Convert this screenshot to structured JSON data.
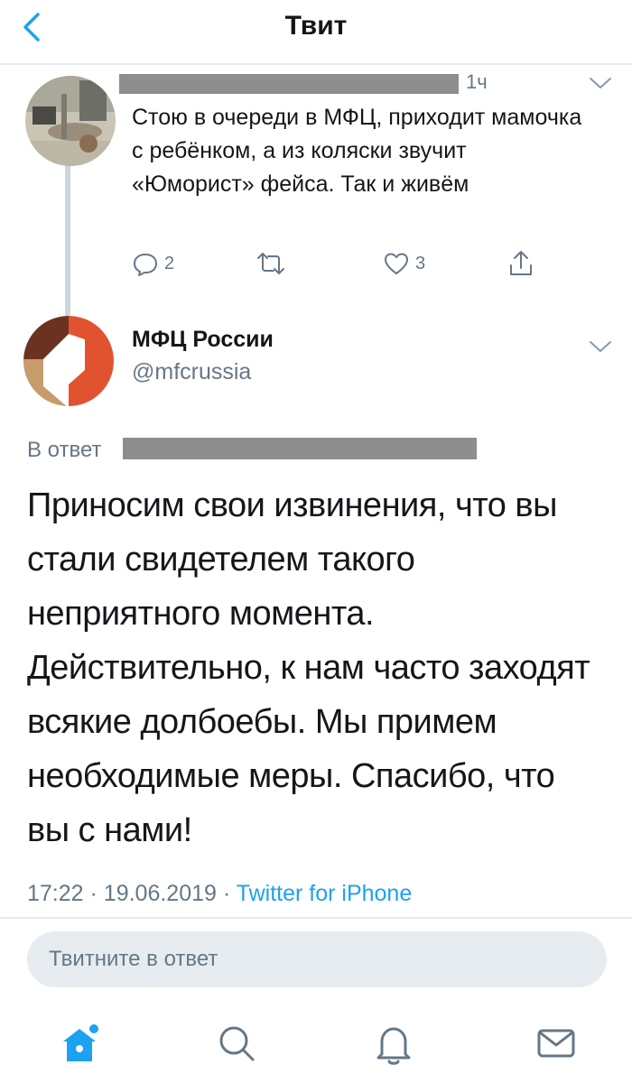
{
  "header": {
    "title": "Твит",
    "back_icon": "chevron-left-icon"
  },
  "reply_tweet": {
    "time_ago": "1ч",
    "text": "Стою в очереди в МФЦ, приходит мамочка с ребёнком, а из коляски звучит «Юморист» фейса. Так и живём",
    "reply_count": "2",
    "retweet_count": "",
    "like_count": "3"
  },
  "main_tweet": {
    "name": "МФЦ России",
    "handle": "@mfcrussia",
    "in_reply_label": "В ответ",
    "text": "Приносим свои извинения, что вы стали свидетелем такого неприятного момента. Действительно, к нам часто заходят всякие долбоебы. Мы примем необходимые меры. Спасибо, что вы с нами!",
    "time": "17:22",
    "date": "19.06.2019",
    "separator": "·",
    "source": "Twitter for iPhone"
  },
  "compose": {
    "placeholder": "Твитните в ответ"
  },
  "tabs": [
    {
      "icon": "home-icon"
    },
    {
      "icon": "search-icon"
    },
    {
      "icon": "bell-icon"
    },
    {
      "icon": "mail-icon"
    }
  ],
  "colors": {
    "accent": "#1da1f2",
    "secondary_text": "#657786",
    "divider": "#e6ecf0",
    "logo_dark": "#6b3221",
    "logo_orange": "#e1532f",
    "logo_tan": "#c69c6d"
  }
}
